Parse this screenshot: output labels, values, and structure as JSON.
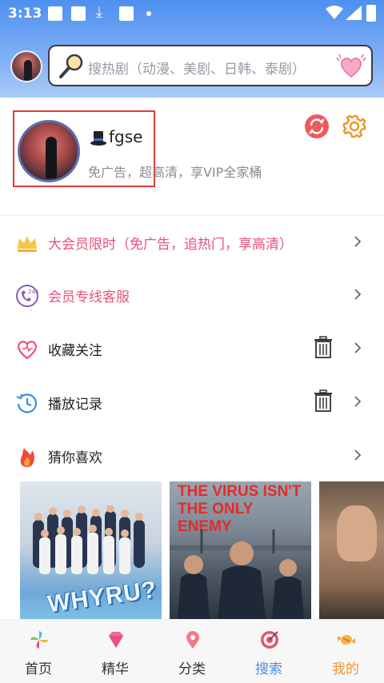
{
  "status_bar": {
    "time": "3:13"
  },
  "search": {
    "placeholder": "搜热剧（动漫、美剧、日韩、泰剧）"
  },
  "profile": {
    "username": "fgse",
    "subtitle": "免广告，超高清，享VIP全家桶"
  },
  "menu": [
    {
      "label": "大会员限时（免广告，追热门，享高清）",
      "icon": "crown-icon",
      "color": "#e8527a"
    },
    {
      "label": "会员专线客服",
      "icon": "phone-24h-icon",
      "color": "#e8527a"
    },
    {
      "label": "收藏关注",
      "icon": "heart-outline-icon",
      "trash": true
    },
    {
      "label": "播放记录",
      "icon": "history-icon",
      "trash": true
    },
    {
      "label": "猜你喜欢",
      "icon": "fire-icon"
    }
  ],
  "posters": {
    "p1_title": "WHYRU?",
    "p2_title": "THE VIRUS ISN'T THE ONLY ENEMY"
  },
  "bottom_nav": [
    {
      "label": "首页",
      "icon": "pinwheel-icon"
    },
    {
      "label": "精华",
      "icon": "gem-icon"
    },
    {
      "label": "分类",
      "icon": "location-pin-icon"
    },
    {
      "label": "搜索",
      "icon": "target-icon",
      "active_color": "#4a8ee8"
    },
    {
      "label": "我的",
      "icon": "candy-icon",
      "active_color": "#f0962a"
    }
  ],
  "colors": {
    "accent_blue": "#4f8ff0",
    "pink": "#e8527a",
    "orange": "#f0962a",
    "red": "#e23a3a"
  }
}
